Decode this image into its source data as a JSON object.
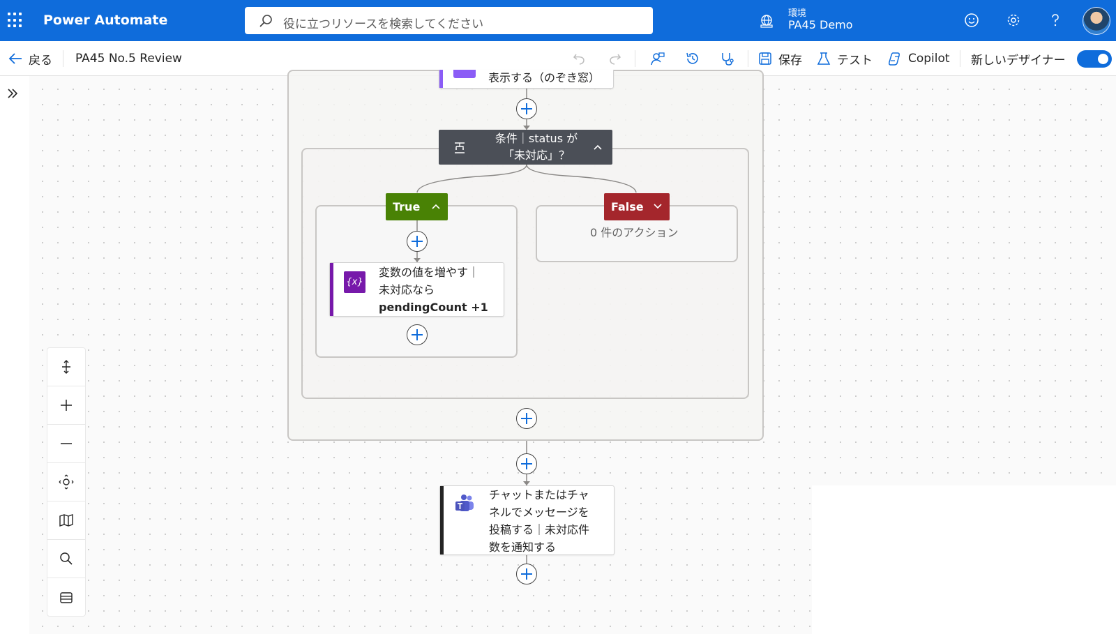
{
  "header": {
    "app_title": "Power Automate",
    "search_placeholder": "役に立つリソースを検索してください",
    "environment_label": "環境",
    "environment_value": "PA45 Demo"
  },
  "command_bar": {
    "back_label": "戻る",
    "flow_name": "PA45 No.5 Review",
    "save_label": "保存",
    "test_label": "テスト",
    "copilot_label": "Copilot",
    "new_designer_label": "新しいデザイナー",
    "new_designer_enabled": true
  },
  "flow": {
    "top_action_partial_text": "表示する（のぞき窓）",
    "condition_title_line1": "条件｜status が",
    "condition_title_line2": "「未対応」？",
    "true_label": "True",
    "false_label": "False",
    "false_empty_text": "0 件のアクション",
    "increment_action": {
      "line1": "変数の値を増やす｜",
      "line2": "未対応なら",
      "line3": "pendingCount +1"
    },
    "teams_action": {
      "line1": "チャットまたはチャ",
      "line2": "ネルでメッセージを",
      "line3": "投稿する｜未対応件",
      "line4": "数を通知する"
    },
    "colors": {
      "true": "#498205",
      "false": "#a4262c",
      "condition": "#4b4f57",
      "variable": "#7719aa",
      "teams": "#242424",
      "brand": "#0f6cdb"
    }
  }
}
